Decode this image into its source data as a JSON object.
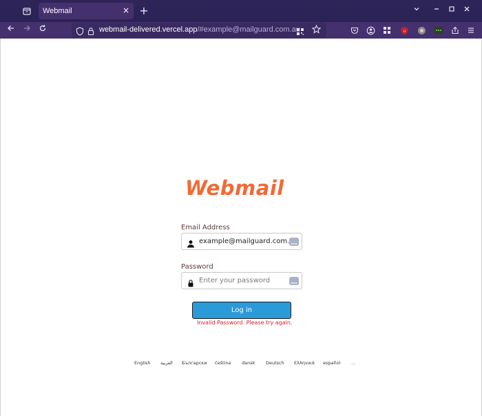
{
  "browser": {
    "tab_title": "Webmail",
    "tab_close": "×",
    "new_tab": "+",
    "url_host": "webmail-delivered.vercel.app",
    "url_rest": "/#example@mailguard.com.au"
  },
  "page": {
    "logo_text": "Webmail",
    "email": {
      "label": "Email Address",
      "value": "example@mailguard.com.au"
    },
    "password": {
      "label": "Password",
      "placeholder": "Enter your password"
    },
    "login_label": "Log in",
    "error_message": "Invalid Password. Please try again.",
    "languages": [
      "English",
      "العربية",
      "Български",
      "čeština",
      "dansk",
      "Deutsch",
      "Ελληνικά",
      "español",
      "..."
    ]
  },
  "colors": {
    "brand": "#f06a35",
    "button": "#2b9ad9",
    "error": "#e0171d"
  }
}
